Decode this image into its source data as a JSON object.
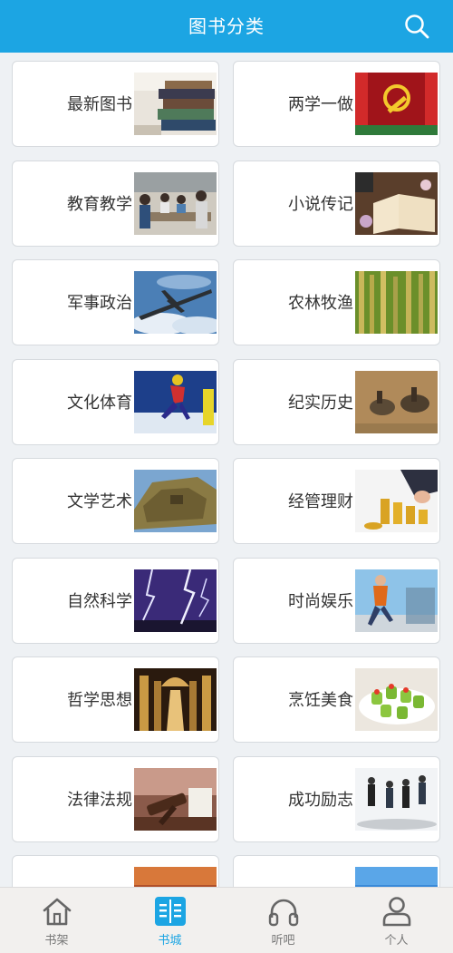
{
  "header": {
    "title": "图书分类",
    "search_icon": "search-icon"
  },
  "categories": [
    {
      "label": "最新图书",
      "image": "book-stack"
    },
    {
      "label": "两学一做",
      "image": "party-flag"
    },
    {
      "label": "教育教学",
      "image": "classroom"
    },
    {
      "label": "小说传记",
      "image": "open-book"
    },
    {
      "label": "军事政治",
      "image": "aircraft"
    },
    {
      "label": "农林牧渔",
      "image": "rice-field"
    },
    {
      "label": "文化体育",
      "image": "skater"
    },
    {
      "label": "纪实历史",
      "image": "ancient-painting"
    },
    {
      "label": "文学艺术",
      "image": "sculpture"
    },
    {
      "label": "经管理财",
      "image": "gold-coins"
    },
    {
      "label": "自然科学",
      "image": "lightning"
    },
    {
      "label": "时尚娱乐",
      "image": "jumping-man"
    },
    {
      "label": "哲学思想",
      "image": "library-hall"
    },
    {
      "label": "烹饪美食",
      "image": "dish"
    },
    {
      "label": "法律法规",
      "image": "gavel"
    },
    {
      "label": "成功励志",
      "image": "businesspeople"
    },
    {
      "label": "",
      "image": "sunset"
    },
    {
      "label": "",
      "image": "sky"
    }
  ],
  "tabs": [
    {
      "label": "书架",
      "icon": "home-icon",
      "active": false
    },
    {
      "label": "书城",
      "icon": "book-city-icon",
      "active": true
    },
    {
      "label": "听吧",
      "icon": "headphones-icon",
      "active": false
    },
    {
      "label": "个人",
      "icon": "person-icon",
      "active": false
    }
  ],
  "colors": {
    "brand": "#1ca5e3",
    "background": "#eef1f4",
    "text": "#333333",
    "tab_inactive": "#777777"
  }
}
